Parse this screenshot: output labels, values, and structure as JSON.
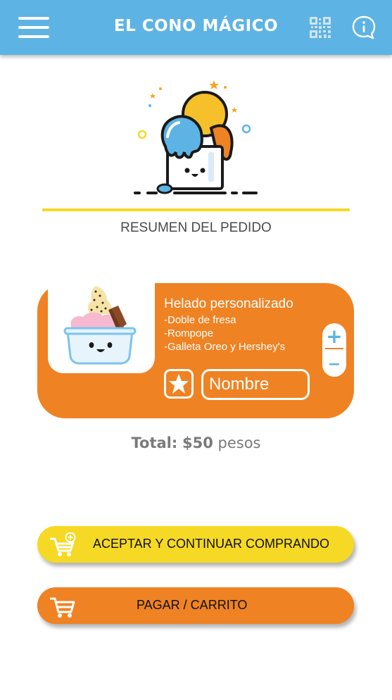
{
  "header": {
    "title": "EL CONO MÁGICO",
    "menu_icon": "hamburger-menu-icon",
    "qr_icon": "qr-code-icon",
    "info_icon": "info-icon",
    "bar_color": "#5db3e4"
  },
  "logo": {
    "icon": "ice-cream-cup-mascot-icon"
  },
  "section": {
    "title": "RESUMEN DEL PEDIDO"
  },
  "order": {
    "product_name": "Helado personalizado",
    "details": [
      "-Doble de fresa",
      "-Rompope",
      "-Galleta Oreo y Hershey's"
    ],
    "image_icon": "ice-cream-cup-icon",
    "plus_label": "+",
    "minus_label": "−",
    "favorite_icon": "star-icon",
    "name_placeholder": "Nombre",
    "card_color": "#ef8223"
  },
  "total": {
    "label": "Total:",
    "amount": "$50",
    "unit": "pesos"
  },
  "buttons": {
    "accept_label": "ACEPTAR Y CONTINUAR COMPRANDO",
    "accept_icon": "add-to-cart-icon",
    "accept_color": "#f5d924",
    "pay_label": "PAGAR / CARRITO",
    "pay_icon": "cart-icon",
    "pay_color": "#ef8223"
  }
}
